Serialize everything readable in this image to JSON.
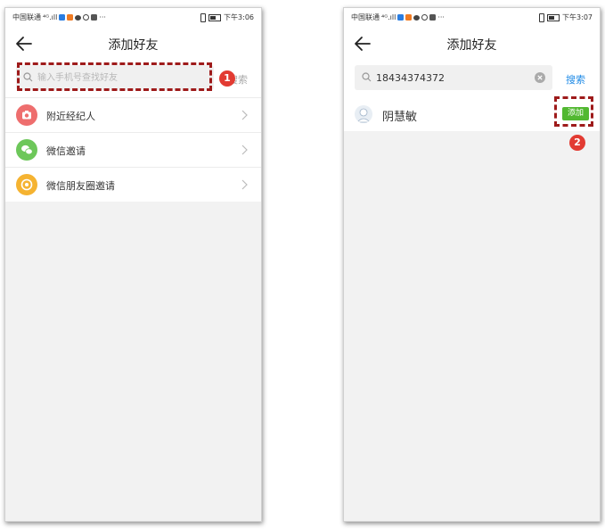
{
  "screen1": {
    "status": {
      "carrier": "中国联通",
      "signal": "⁴ᴳ.ıll",
      "more": "···",
      "time": "下午3:06"
    },
    "title": "添加好友",
    "search": {
      "placeholder": "输入手机号查找好友",
      "value": "",
      "button": "搜索"
    },
    "menu": [
      {
        "label": "附近经纪人",
        "icon": "camera-icon",
        "color": "#ee6e6e"
      },
      {
        "label": "微信邀请",
        "icon": "wechat-icon",
        "color": "#6dc75a"
      },
      {
        "label": "微信朋友圈邀请",
        "icon": "moments-icon",
        "color": "#f5b331"
      }
    ],
    "step_badge": "1"
  },
  "screen2": {
    "status": {
      "carrier": "中国联通",
      "signal": "⁴ᴳ.ıll",
      "more": "···",
      "time": "下午3:07"
    },
    "title": "添加好友",
    "search": {
      "value": "18434374372",
      "button": "搜索"
    },
    "result": {
      "name": "阴慧敏",
      "add_label": "添加"
    },
    "step_badge": "2"
  },
  "colors": {
    "accent_blue": "#1e8ae6",
    "add_green": "#52b831",
    "annotation_red": "#9e1b1b",
    "badge_red": "#e23b32"
  }
}
